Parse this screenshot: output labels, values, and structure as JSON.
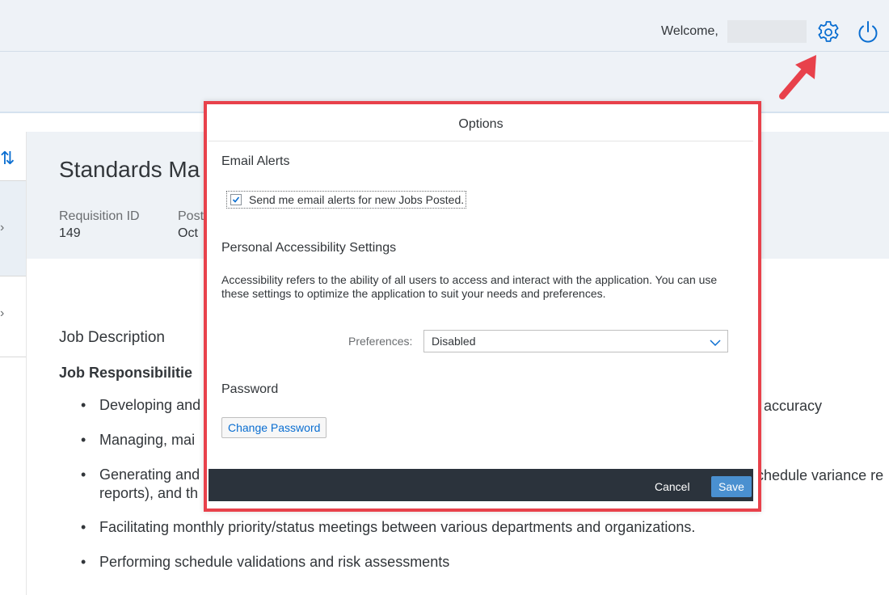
{
  "header": {
    "welcome_label": "Welcome,",
    "user_name": "",
    "settings_icon": "gear-icon",
    "logout_icon": "power-icon"
  },
  "side_nav": {
    "sort_icon": "sort-arrows-icon"
  },
  "object_header": {
    "title": "Standards Ma",
    "attributes": [
      {
        "label": "Requisition ID",
        "value": "149"
      },
      {
        "label": "Post",
        "value": "Oct"
      }
    ]
  },
  "content": {
    "job_description_heading": "Job Description",
    "job_responsibilities_heading": "Job Responsibilitie",
    "bullets": [
      "Developing and",
      "Managing, mai",
      "Generating and",
      "Facilitating monthly priority/status meetings between various departments and organizations.",
      "Performing schedule validations and risk assessments"
    ],
    "bullet1_tail": "d accuracy",
    "bullet3_tail": "chedule variance re",
    "bullet3_line2": "reports), and th"
  },
  "dialog": {
    "title": "Options",
    "email_alerts_heading": "Email Alerts",
    "email_alerts_checkbox_label": "Send me email alerts for new Jobs Posted.",
    "email_alerts_checked": true,
    "accessibility_heading": "Personal Accessibility Settings",
    "accessibility_text": "Accessibility refers to the ability of all users to access and interact with the application. You can use these settings to optimize the application to suit your needs and preferences.",
    "preferences_label": "Preferences:",
    "preferences_value": "Disabled",
    "password_heading": "Password",
    "change_password_label": "Change Password",
    "cancel_label": "Cancel",
    "save_label": "Save"
  },
  "colors": {
    "accent": "#0a6ed1",
    "annotation_red": "#e8414b",
    "footer_bg": "#2b333c",
    "save_bg": "#4a90d0"
  }
}
